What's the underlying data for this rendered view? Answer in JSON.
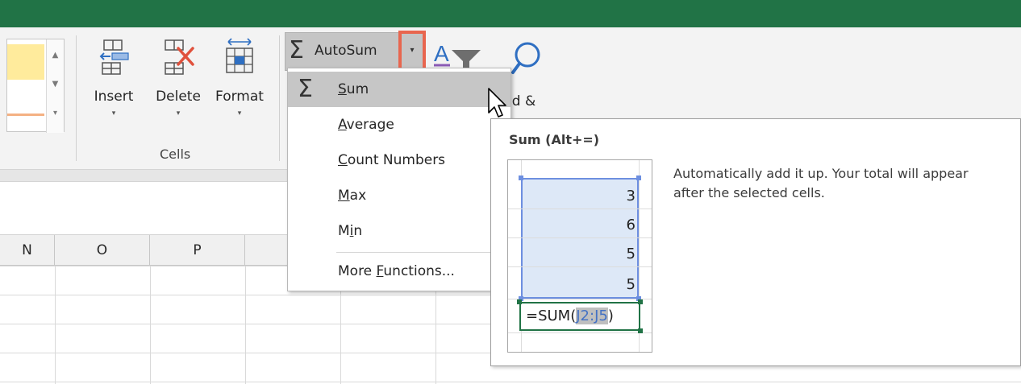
{
  "ribbon": {
    "cells_group": {
      "label": "Cells",
      "insert_label": "Insert",
      "delete_label": "Delete",
      "format_label": "Format",
      "dropdown_glyph": "▾"
    },
    "editing": {
      "autosum_label": "AutoSum",
      "autosum_symbol": "Σ",
      "autosum_dropdown_glyph": "▾",
      "find_label_partial": "nd &"
    }
  },
  "columns": [
    "N",
    "O",
    "P"
  ],
  "autosum_menu": {
    "items": [
      {
        "label_before": "",
        "accel": "S",
        "label_after": "um",
        "hover": true
      },
      {
        "label_before": "",
        "accel": "A",
        "label_after": "verage"
      },
      {
        "label_before": "",
        "accel": "C",
        "label_after": "ount Numbers"
      },
      {
        "label_before": "",
        "accel": "M",
        "label_after": "ax"
      },
      {
        "label_before": "M",
        "accel": "i",
        "label_after": "n"
      },
      {
        "label_before": "More ",
        "accel": "F",
        "label_after": "unctions..."
      }
    ]
  },
  "tooltip": {
    "title": "Sum (Alt+=)",
    "description": "Automatically add it up. Your total will appear after the selected cells.",
    "example_values": [
      "3",
      "6",
      "5",
      "5"
    ],
    "formula_prefix": "=SUM(",
    "formula_ref": "J2:J5",
    "formula_suffix": ")"
  },
  "colors": {
    "title_bar": "#217346",
    "highlight_outline": "#e8664f",
    "selection_border": "#6d8fe0",
    "selection_fill": "#dde8f7"
  }
}
